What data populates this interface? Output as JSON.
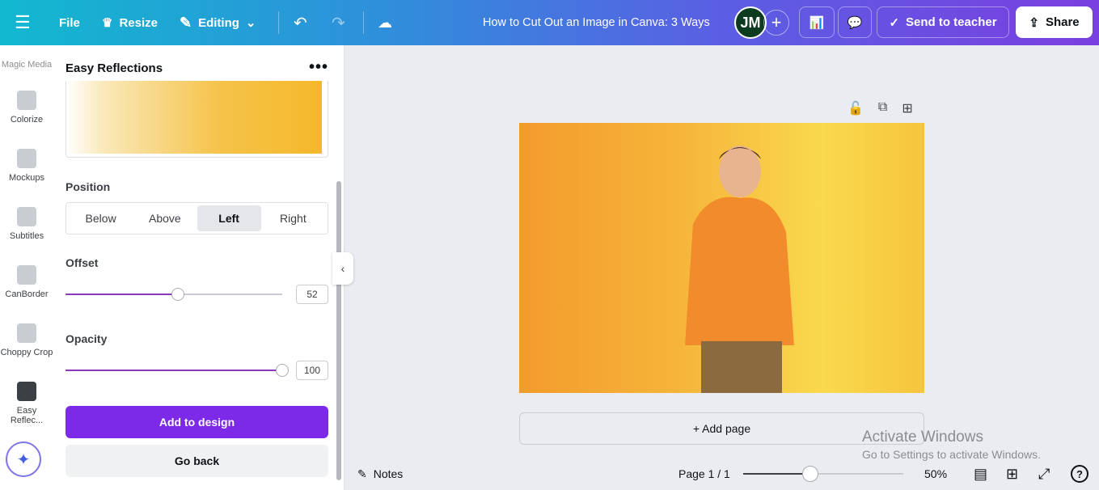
{
  "topbar": {
    "menu_icon": "hamburger-icon",
    "file": "File",
    "resize": "Resize",
    "editing": "Editing",
    "title": "How to Cut Out an Image in Canva: 3 Ways",
    "avatar_initials": "JM",
    "send_to_teacher": "Send to teacher",
    "share": "Share"
  },
  "rail": {
    "items": [
      {
        "label": "Magic Media"
      },
      {
        "label": "Colorize"
      },
      {
        "label": "Mockups"
      },
      {
        "label": "Subtitles"
      },
      {
        "label": "CanBorder"
      },
      {
        "label": "Choppy Crop"
      },
      {
        "label": "Easy Reflec..."
      }
    ]
  },
  "panel": {
    "title": "Easy Reflections",
    "position_label": "Position",
    "position_options": [
      "Below",
      "Above",
      "Left",
      "Right"
    ],
    "position_selected": "Left",
    "offset_label": "Offset",
    "offset_value": "52",
    "offset_fraction": 0.52,
    "opacity_label": "Opacity",
    "opacity_value": "100",
    "opacity_fraction": 1.0,
    "add_button": "Add to design",
    "back_button": "Go back"
  },
  "canvas": {
    "add_page": "+ Add page"
  },
  "footer": {
    "notes": "Notes",
    "page": "Page 1 / 1",
    "zoom": "50%",
    "zoom_fraction": 0.42
  },
  "watermark": {
    "line1": "Activate Windows",
    "line2": "Go to Settings to activate Windows."
  }
}
